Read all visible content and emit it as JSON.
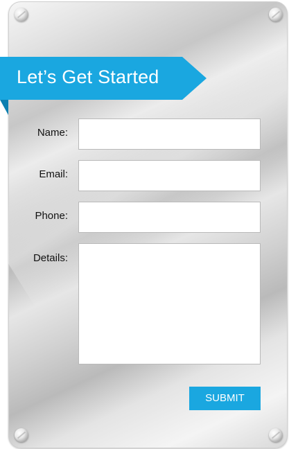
{
  "header": {
    "title": "Let’s Get Started"
  },
  "form": {
    "fields": [
      {
        "label": "Name:",
        "value": "",
        "placeholder": ""
      },
      {
        "label": "Email:",
        "value": "",
        "placeholder": ""
      },
      {
        "label": "Phone:",
        "value": "",
        "placeholder": ""
      },
      {
        "label": "Details:",
        "value": "",
        "placeholder": ""
      }
    ],
    "submit_label": "SUBMIT"
  },
  "colors": {
    "accent": "#1aa7e0",
    "accent_dark": "#0d7fb0",
    "field_background": "#ffffff",
    "plate": "#d0d0d0"
  },
  "icons": {
    "corner_screws": [
      "screw-icon",
      "screw-icon",
      "screw-icon",
      "screw-icon"
    ]
  }
}
